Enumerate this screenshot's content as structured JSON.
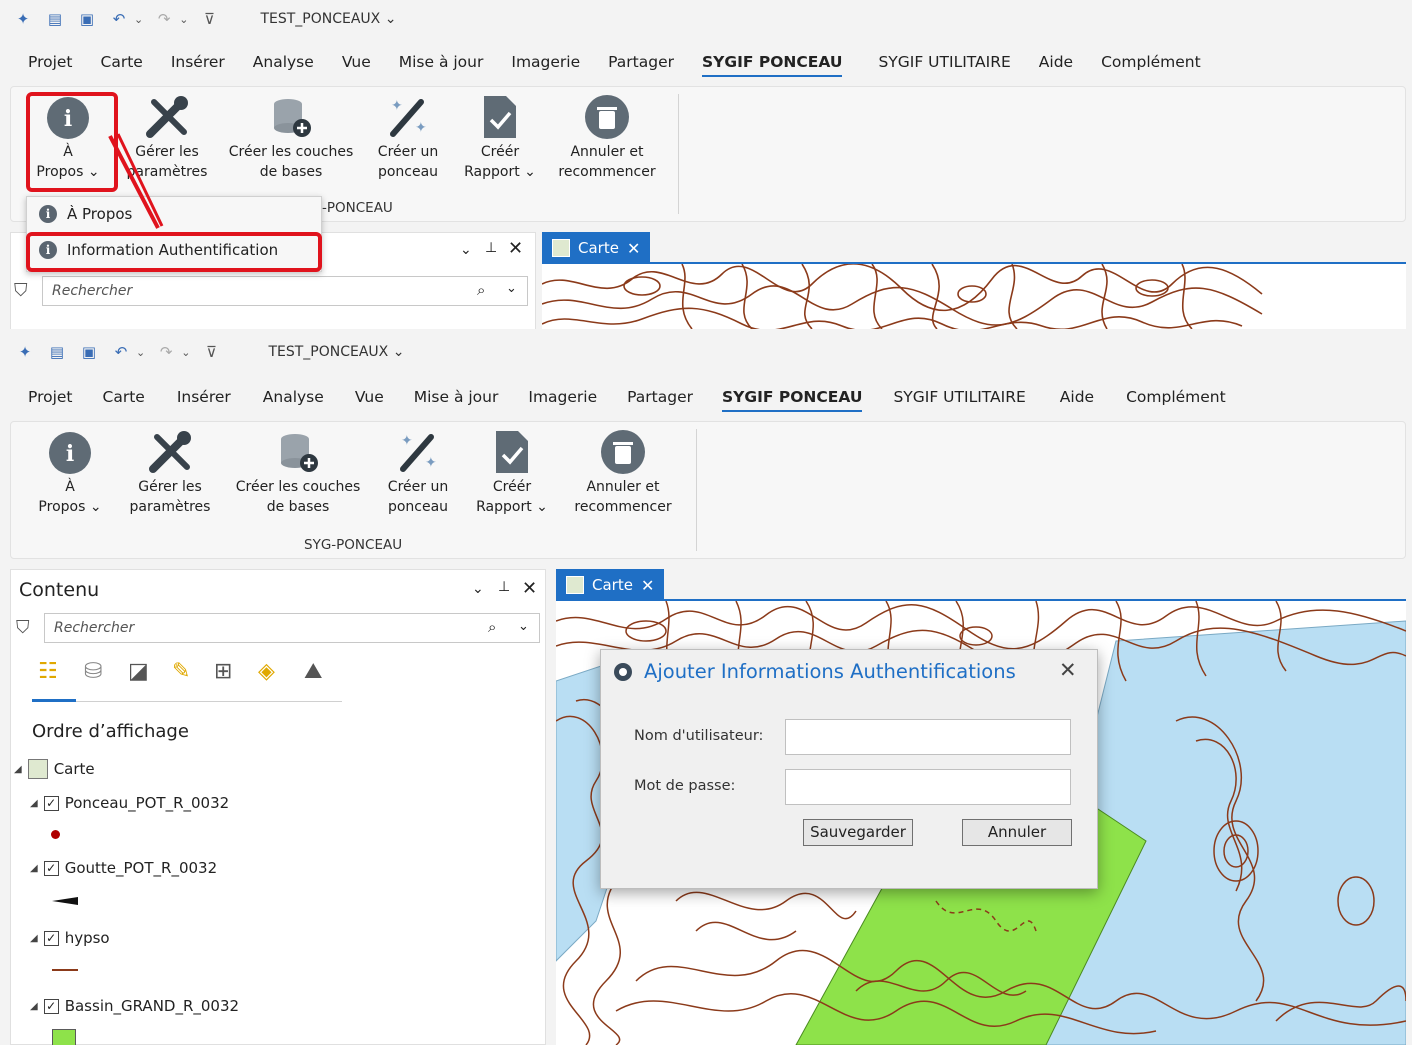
{
  "qat": {
    "title": "TEST_PONCEAUX"
  },
  "menu": [
    "Projet",
    "Carte",
    "Insérer",
    "Analyse",
    "Vue",
    "Mise à jour",
    "Imagerie",
    "Partager",
    "SYGIF PONCEAU",
    "SYGIF UTILITAIRE",
    "Aide",
    "Complément"
  ],
  "ribbon": {
    "apropos": [
      "À",
      "Propos"
    ],
    "gerer": [
      "Gérer les",
      "paramètres"
    ],
    "creer_couches": [
      "Créer les couches",
      "de bases"
    ],
    "creer_ponceau": [
      "Créer un",
      "ponceau"
    ],
    "creer_rapport": [
      "Créér",
      "Rapport"
    ],
    "annuler": [
      "Annuler et",
      "recommencer"
    ],
    "group_label": "SYG-PONCEAU",
    "group_label_partial": "-PONCEAU"
  },
  "dropdown": {
    "item1": "À Propos",
    "item2": "Information Authentification"
  },
  "contents": {
    "title": "Contenu",
    "search_placeholder": "Rechercher",
    "order_title": "Ordre d’affichage",
    "map_node": "Carte",
    "layers": [
      "Ponceau_POT_R_0032",
      "Goutte_POT_R_0032",
      "hypso",
      "Bassin_GRAND_R_0032"
    ]
  },
  "map_tab": {
    "label": "Carte"
  },
  "dialog": {
    "title": "Ajouter Informations Authentifications",
    "username_label": "Nom d'utilisateur:",
    "password_label": "Mot de passe:",
    "save_button": "Sauvegarder",
    "cancel_button": "Annuler"
  },
  "colors": {
    "accent": "#1f6fc5",
    "highlight": "#e0131d",
    "contour": "#8b3a1a",
    "water": "#b9def3",
    "basin": "#8ee24a"
  }
}
